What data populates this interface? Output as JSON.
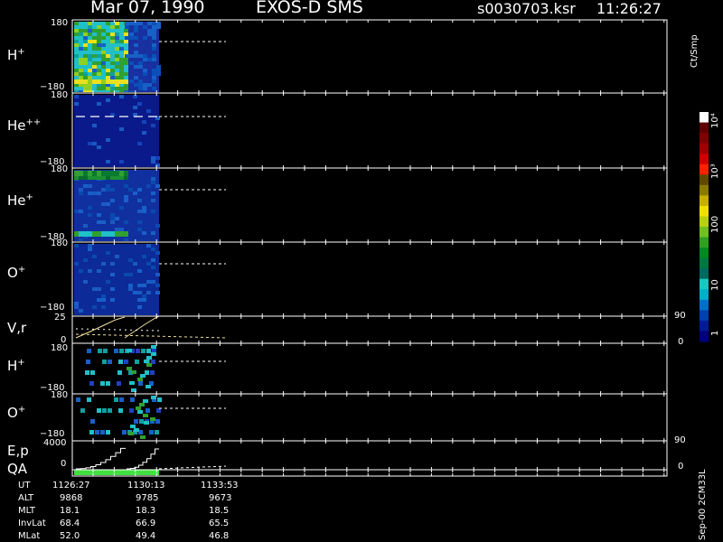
{
  "header": {
    "date": "Mar 07, 1990",
    "instrument": "EXOS-D SMS",
    "file": "s0030703.ksr",
    "time": "11:26:27"
  },
  "colorbar": {
    "unit": "Ct/Smp",
    "ticks": [
      "1",
      "10",
      "100",
      "10³",
      "10⁴"
    ],
    "colors": [
      "#000080",
      "#001a99",
      "#0040b3",
      "#0070cc",
      "#00b0c8",
      "#18c8c0",
      "#006a60",
      "#007840",
      "#008a20",
      "#30a020",
      "#70c020",
      "#b8d010",
      "#f0e000",
      "#c8b000",
      "#8a7a00",
      "#604800",
      "#ff2000",
      "#d00000",
      "#a00000",
      "#800000",
      "#600000",
      "#ffffff"
    ]
  },
  "panels": {
    "hplus": {
      "label": "H",
      "sup": "+",
      "ymax": "180",
      "ymin": "−180"
    },
    "heplus2": {
      "label": "He",
      "sup": "++",
      "ymax": "180",
      "ymin": "−180"
    },
    "heplus": {
      "label": "He",
      "sup": "+",
      "ymax": "180",
      "ymin": "−180"
    },
    "oplus": {
      "label": "O",
      "sup": "+",
      "ymax": "180",
      "ymin": "−180"
    },
    "vr": {
      "label": "V,r",
      "ymax": "25",
      "ymin": "0",
      "rmax": "90",
      "rmin": "0"
    },
    "hplus2": {
      "label": "H",
      "sup": "+",
      "ymax": "180",
      "ymin": "−180"
    },
    "oplus2": {
      "label": "O",
      "sup": "+",
      "ymax": "180",
      "ymin": "−180"
    },
    "ep": {
      "label": "E,p",
      "ymax": "4000",
      "ymin": "0",
      "rmax": "90",
      "rmin": "0"
    },
    "qa": {
      "label": "QA"
    }
  },
  "footer": {
    "rows": [
      {
        "name": "UT",
        "values": [
          "1126:27",
          "1130:13",
          "1133:53"
        ]
      },
      {
        "name": "ALT",
        "values": [
          "9868",
          "9785",
          "9673"
        ]
      },
      {
        "name": "MLT",
        "values": [
          "18.1",
          "18.3",
          "18.5"
        ]
      },
      {
        "name": "InvLat",
        "values": [
          "68.4",
          "66.9",
          "65.5"
        ]
      },
      {
        "name": "MLat",
        "values": [
          "52.0",
          "49.4",
          "46.8"
        ]
      }
    ],
    "side_label": "Sep-00 2CM33L"
  },
  "chart_data": {
    "type": "heatmap",
    "title": "Mar 07, 1990   EXOS-D SMS",
    "x_ticks": [
      "1126:27",
      "1130:13",
      "1133:53"
    ],
    "colorbar": {
      "label": "Ct/Smp",
      "scale": "log",
      "range": [
        1,
        10000
      ]
    },
    "panels": [
      {
        "name": "H+",
        "ylim": [
          -180,
          180
        ],
        "data_extent_ut": [
          "1126:27",
          "1130:13"
        ]
      },
      {
        "name": "He++",
        "ylim": [
          -180,
          180
        ],
        "data_extent_ut": [
          "1126:27",
          "1130:13"
        ]
      },
      {
        "name": "He+",
        "ylim": [
          -180,
          180
        ],
        "data_extent_ut": [
          "1126:27",
          "1130:13"
        ]
      },
      {
        "name": "O+",
        "ylim": [
          -180,
          180
        ],
        "data_extent_ut": [
          "1126:27",
          "1130:13"
        ]
      },
      {
        "name": "V,r",
        "ylim": [
          0,
          25
        ],
        "right_ylim": [
          0,
          90
        ]
      },
      {
        "name": "H+",
        "ylim": [
          -180,
          180
        ]
      },
      {
        "name": "O+",
        "ylim": [
          -180,
          180
        ]
      },
      {
        "name": "E,p",
        "ylim": [
          0,
          4000
        ],
        "right_ylim": [
          0,
          90
        ]
      },
      {
        "name": "QA"
      }
    ]
  }
}
